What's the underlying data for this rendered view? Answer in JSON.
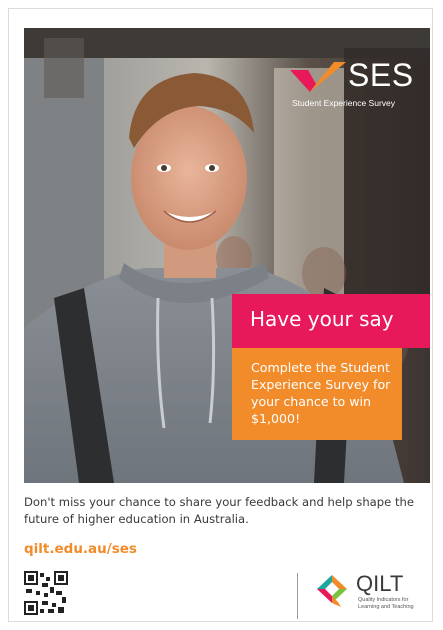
{
  "hero": {
    "brand_title": "SES",
    "brand_subtitle": "Student Experience Survey",
    "headline": "Have your say",
    "offer": "Complete the Student Experience Survey for your chance to win $1,000!"
  },
  "footer": {
    "message": "Don't miss your chance to share your feedback and help shape the future of higher education in Australia.",
    "url": "qilt.edu.au/ses",
    "partner_name": "QILT",
    "partner_tagline": "Quality Indicators for Learning and Teaching"
  },
  "icons": {
    "brand_mark": "ses-check-icon",
    "qr": "qr-code-icon",
    "partner_logo": "qilt-logo-icon"
  },
  "colors": {
    "pink": "#e8195a",
    "orange": "#f28b2a",
    "text": "#3a3a3a"
  }
}
